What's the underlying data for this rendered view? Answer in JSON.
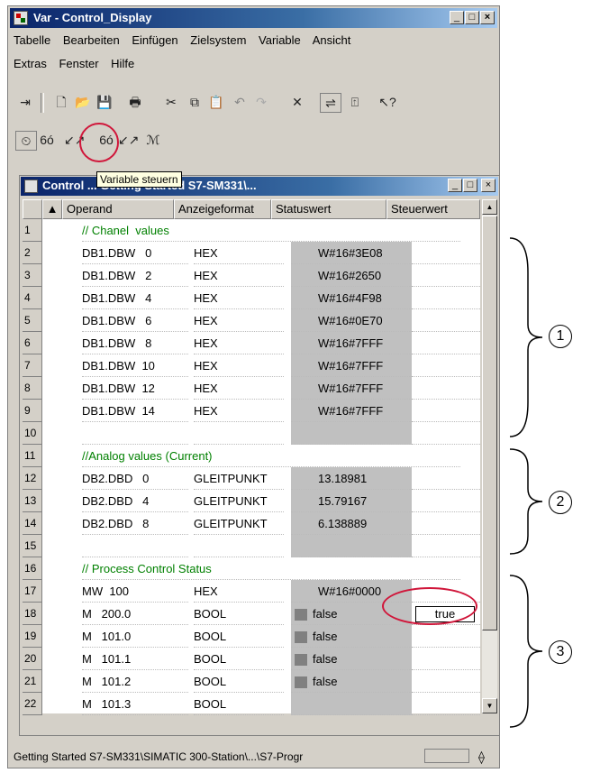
{
  "window": {
    "title": "Var - Control_Display"
  },
  "menu": {
    "row1": [
      "Tabelle",
      "Bearbeiten",
      "Einfügen",
      "Zielsystem",
      "Variable",
      "Ansicht"
    ],
    "row2": [
      "Extras",
      "Fenster",
      "Hilfe"
    ]
  },
  "tooltip": "Variable steuern",
  "table_window": {
    "title": "Control ... Getting Started S7-SM331\\..."
  },
  "table": {
    "headers": [
      "Operand",
      "Anzeigeformat",
      "Statuswert",
      "Steuerwert"
    ],
    "rows": [
      {
        "n": "1",
        "comment": "// Chanel  values"
      },
      {
        "n": "2",
        "op": "DB1.DBW   0",
        "fmt": "HEX",
        "val": "W#16#3E08"
      },
      {
        "n": "3",
        "op": "DB1.DBW   2",
        "fmt": "HEX",
        "val": "W#16#2650"
      },
      {
        "n": "4",
        "op": "DB1.DBW   4",
        "fmt": "HEX",
        "val": "W#16#4F98"
      },
      {
        "n": "5",
        "op": "DB1.DBW   6",
        "fmt": "HEX",
        "val": "W#16#0E70"
      },
      {
        "n": "6",
        "op": "DB1.DBW   8",
        "fmt": "HEX",
        "val": "W#16#7FFF"
      },
      {
        "n": "7",
        "op": "DB1.DBW  10",
        "fmt": "HEX",
        "val": "W#16#7FFF"
      },
      {
        "n": "8",
        "op": "DB1.DBW  12",
        "fmt": "HEX",
        "val": "W#16#7FFF"
      },
      {
        "n": "9",
        "op": "DB1.DBW  14",
        "fmt": "HEX",
        "val": "W#16#7FFF"
      },
      {
        "n": "10"
      },
      {
        "n": "11",
        "comment": "//Analog values (Current)"
      },
      {
        "n": "12",
        "op": "DB2.DBD   0",
        "fmt": "GLEITPUNKT",
        "val": "13.18981"
      },
      {
        "n": "13",
        "op": "DB2.DBD   4",
        "fmt": "GLEITPUNKT",
        "val": "15.79167"
      },
      {
        "n": "14",
        "op": "DB2.DBD   8",
        "fmt": "GLEITPUNKT",
        "val": "6.138889"
      },
      {
        "n": "15"
      },
      {
        "n": "16",
        "comment": "// Process Control Status"
      },
      {
        "n": "17",
        "op": "MW  100",
        "fmt": "HEX",
        "val": "W#16#0000"
      },
      {
        "n": "18",
        "op": "M   200.0",
        "fmt": "BOOL",
        "val": "false",
        "ctrl": "true"
      },
      {
        "n": "19",
        "op": "M   101.0",
        "fmt": "BOOL",
        "val": "false"
      },
      {
        "n": "20",
        "op": "M   101.1",
        "fmt": "BOOL",
        "val": "false"
      },
      {
        "n": "21",
        "op": "M   101.2",
        "fmt": "BOOL",
        "val": "false"
      },
      {
        "n": "22",
        "op": "M   101.3",
        "fmt": "BOOL",
        "val": ""
      }
    ]
  },
  "statusbar": "Getting Started S7-SM331\\SIMATIC 300-Station\\...\\S7-Progr",
  "markers": [
    "1",
    "2",
    "3"
  ]
}
